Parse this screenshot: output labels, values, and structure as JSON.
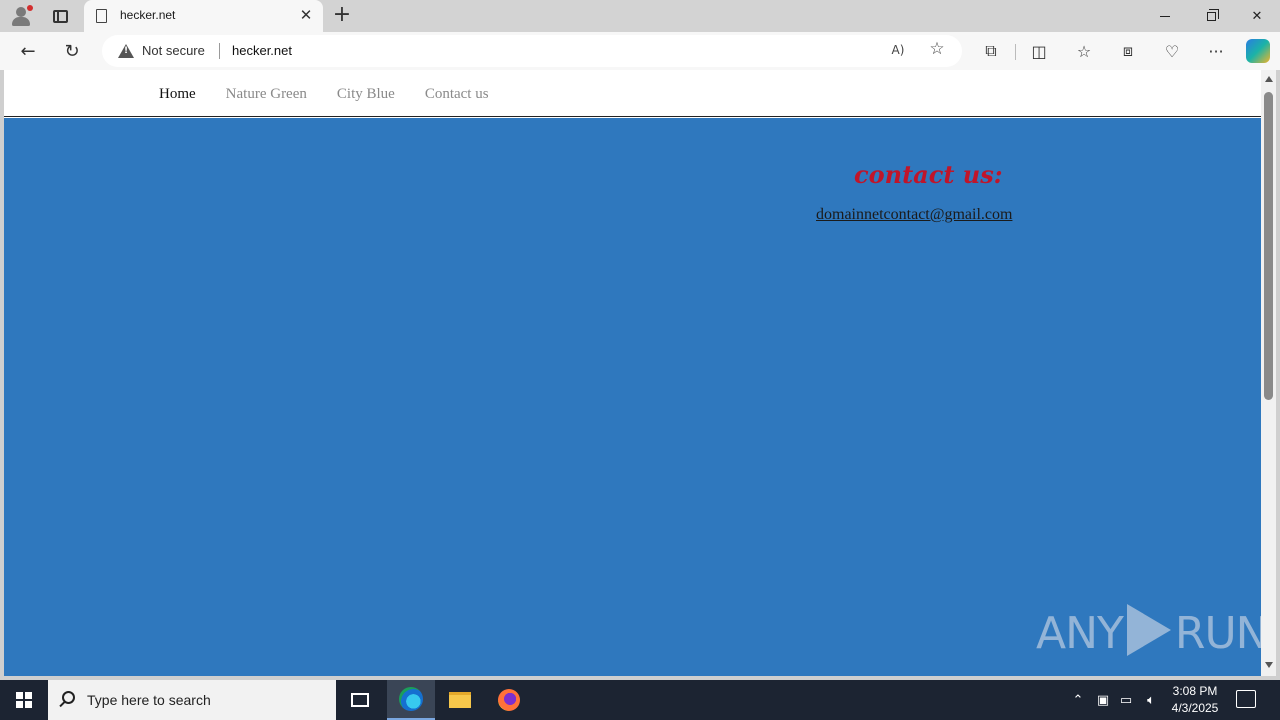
{
  "browser": {
    "tab_title": "hecker.net",
    "security_label": "Not secure",
    "url": "hecker.net"
  },
  "site": {
    "nav": [
      {
        "label": "Home",
        "active": true
      },
      {
        "label": "Nature Green",
        "active": false
      },
      {
        "label": "City Blue",
        "active": false
      },
      {
        "label": "Contact us",
        "active": false
      }
    ],
    "contact_heading": "contact us:",
    "contact_email": "domainnetcontact@gmail.com",
    "background_color": "#2f78be",
    "heading_color": "#c0152a"
  },
  "watermark": {
    "left": "ANY",
    "right": "RUN"
  },
  "taskbar": {
    "search_placeholder": "Type here to search",
    "time": "3:08 PM",
    "date": "4/3/2025"
  }
}
